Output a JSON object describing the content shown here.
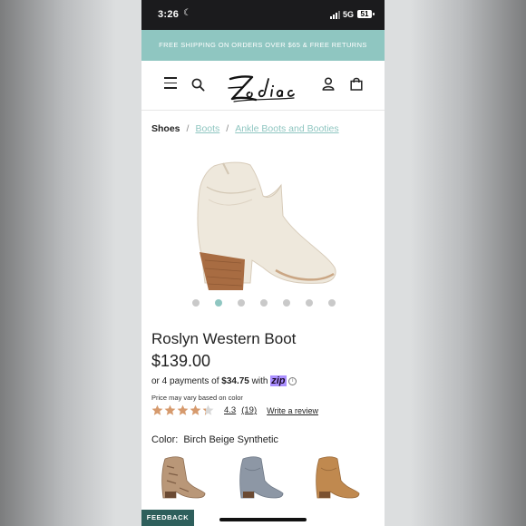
{
  "status_bar": {
    "time": "3:26",
    "network": "5G",
    "battery": "51"
  },
  "promo": {
    "text": "FREE SHIPPING ON ORDERS OVER $65 & FREE RETURNS"
  },
  "header": {
    "logo_text": "Zodiac"
  },
  "breadcrumb": {
    "current": "Shoes",
    "sep1": "/",
    "link1": "Boots",
    "sep2": "/",
    "link2": "Ankle Boots and Booties"
  },
  "carousel": {
    "count": 7,
    "active_index": 1
  },
  "product": {
    "name": "Roslyn Western Boot",
    "price": "$139.00",
    "installments_prefix": "or 4 payments of",
    "installment_amount": "$34.75",
    "installments_with": "with",
    "zip_brand": "zip",
    "info": "i",
    "price_note": "Price may vary based on color",
    "rating_value": "4.3",
    "review_count": "(19)",
    "stars": 4.3,
    "write_review": "Write a review",
    "color_label": "Color:",
    "color_value": "Birch Beige Synthetic"
  },
  "swatches": [
    {
      "name": "snake",
      "color": "#b99778"
    },
    {
      "name": "blue-gray",
      "color": "#8d97a5"
    },
    {
      "name": "tan",
      "color": "#c0894f"
    }
  ],
  "colors": {
    "accent": "#8fc6c1",
    "star": "#d69a6d",
    "feedback_bg": "#2e5f5c"
  },
  "feedback": {
    "label": "FEEDBACK"
  }
}
